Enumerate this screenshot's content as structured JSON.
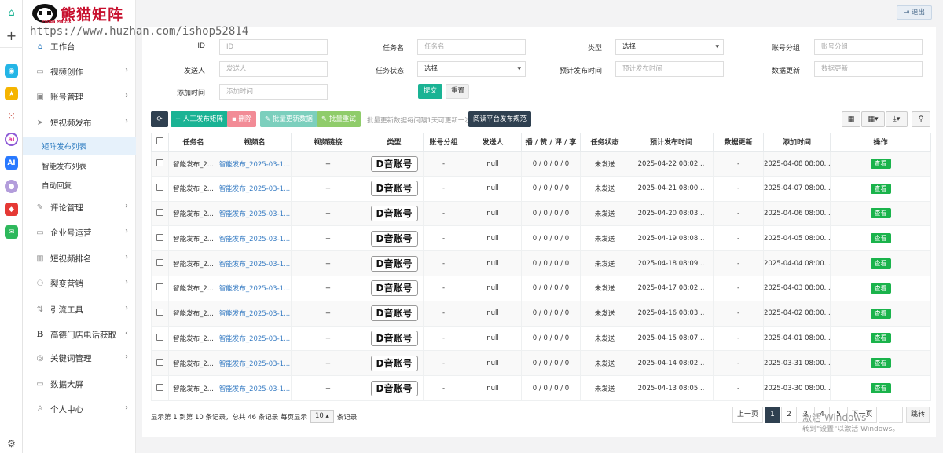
{
  "watermark": "https://www.huzhan.com/ishop52814",
  "logo": {
    "name": "熊猫矩阵",
    "sub": "Panda Matrix"
  },
  "topbar": {
    "logout_label": "退出"
  },
  "sidebar": {
    "items": [
      {
        "label": "工作台",
        "icon": "home-icon"
      },
      {
        "label": "视频创作",
        "icon": "video-icon"
      },
      {
        "label": "账号管理",
        "icon": "account-icon"
      },
      {
        "label": "短视频发布",
        "icon": "send-icon"
      },
      {
        "label": "评论管理",
        "icon": "comment-icon"
      },
      {
        "label": "企业号运营",
        "icon": "monitor-icon"
      },
      {
        "label": "短视频排名",
        "icon": "bar-chart-icon"
      },
      {
        "label": "裂变营销",
        "icon": "sitemap-icon"
      },
      {
        "label": "引流工具",
        "icon": "sort-icon"
      },
      {
        "label": "高德门店电话获取",
        "icon": "bold-b-icon"
      },
      {
        "label": "关键词管理",
        "icon": "target-icon"
      },
      {
        "label": "数据大屏",
        "icon": "screen-icon"
      },
      {
        "label": "个人中心",
        "icon": "user-icon"
      }
    ],
    "subitems": [
      {
        "label": "矩阵发布列表"
      },
      {
        "label": "智能发布列表"
      },
      {
        "label": "自动回复"
      }
    ]
  },
  "filters": {
    "id": {
      "label": "ID",
      "placeholder": "ID"
    },
    "task_name": {
      "label": "任务名",
      "placeholder": "任务名"
    },
    "type": {
      "label": "类型",
      "value": "选择"
    },
    "account_group": {
      "label": "账号分组",
      "placeholder": "账号分组"
    },
    "sender": {
      "label": "发送人",
      "placeholder": "发送人"
    },
    "task_status": {
      "label": "任务状态",
      "value": "选择"
    },
    "plan_time": {
      "label": "预计发布时间",
      "placeholder": "预计发布时间"
    },
    "data_update": {
      "label": "数据更新",
      "placeholder": "数据更新"
    },
    "add_time": {
      "label": "添加时间",
      "placeholder": "添加时间"
    },
    "submit_label": "提交",
    "reset_label": "重置"
  },
  "toolbar": {
    "manual_label": "人工发布矩阵",
    "delete_label": "删除",
    "batch_update_label": "批量更新数据",
    "batch_retry_label": "批量重试",
    "note": "批量更新数据每间隔1天可更新一次",
    "rules_label": "阅读平台发布规范"
  },
  "table": {
    "headers": [
      "任务名",
      "视频名",
      "视频链接",
      "类型",
      "账号分组",
      "发送人",
      "播 / 赞 / 评 / 享",
      "任务状态",
      "预计发布时间",
      "数据更新",
      "添加时间",
      "操作"
    ],
    "rows": [
      {
        "task": "智能发布_2...",
        "video": "智能发布_2025-03-1...",
        "link": "--",
        "type": "D音账号",
        "group": "-",
        "sender": "null",
        "stats": "0 / 0 / 0 / 0",
        "status": "未发送",
        "plan": "2025-04-22 08:02...",
        "update": "-",
        "added": "2025-04-08 08:00...",
        "action": "查看"
      },
      {
        "task": "智能发布_2...",
        "video": "智能发布_2025-03-1...",
        "link": "--",
        "type": "D音账号",
        "group": "-",
        "sender": "null",
        "stats": "0 / 0 / 0 / 0",
        "status": "未发送",
        "plan": "2025-04-21 08:00...",
        "update": "-",
        "added": "2025-04-07 08:00...",
        "action": "查看"
      },
      {
        "task": "智能发布_2...",
        "video": "智能发布_2025-03-1...",
        "link": "--",
        "type": "D音账号",
        "group": "-",
        "sender": "null",
        "stats": "0 / 0 / 0 / 0",
        "status": "未发送",
        "plan": "2025-04-20 08:03...",
        "update": "-",
        "added": "2025-04-06 08:00...",
        "action": "查看"
      },
      {
        "task": "智能发布_2...",
        "video": "智能发布_2025-03-1...",
        "link": "--",
        "type": "D音账号",
        "group": "-",
        "sender": "null",
        "stats": "0 / 0 / 0 / 0",
        "status": "未发送",
        "plan": "2025-04-19 08:08...",
        "update": "-",
        "added": "2025-04-05 08:00...",
        "action": "查看"
      },
      {
        "task": "智能发布_2...",
        "video": "智能发布_2025-03-1...",
        "link": "--",
        "type": "D音账号",
        "group": "-",
        "sender": "null",
        "stats": "0 / 0 / 0 / 0",
        "status": "未发送",
        "plan": "2025-04-18 08:09...",
        "update": "-",
        "added": "2025-04-04 08:00...",
        "action": "查看"
      },
      {
        "task": "智能发布_2...",
        "video": "智能发布_2025-03-1...",
        "link": "--",
        "type": "D音账号",
        "group": "-",
        "sender": "null",
        "stats": "0 / 0 / 0 / 0",
        "status": "未发送",
        "plan": "2025-04-17 08:02...",
        "update": "-",
        "added": "2025-04-03 08:00...",
        "action": "查看"
      },
      {
        "task": "智能发布_2...",
        "video": "智能发布_2025-03-1...",
        "link": "--",
        "type": "D音账号",
        "group": "-",
        "sender": "null",
        "stats": "0 / 0 / 0 / 0",
        "status": "未发送",
        "plan": "2025-04-16 08:03...",
        "update": "-",
        "added": "2025-04-02 08:00...",
        "action": "查看"
      },
      {
        "task": "智能发布_2...",
        "video": "智能发布_2025-03-1...",
        "link": "--",
        "type": "D音账号",
        "group": "-",
        "sender": "null",
        "stats": "0 / 0 / 0 / 0",
        "status": "未发送",
        "plan": "2025-04-15 08:07...",
        "update": "-",
        "added": "2025-04-01 08:00...",
        "action": "查看"
      },
      {
        "task": "智能发布_2...",
        "video": "智能发布_2025-03-1...",
        "link": "--",
        "type": "D音账号",
        "group": "-",
        "sender": "null",
        "stats": "0 / 0 / 0 / 0",
        "status": "未发送",
        "plan": "2025-04-14 08:02...",
        "update": "-",
        "added": "2025-03-31 08:00...",
        "action": "查看"
      },
      {
        "task": "智能发布_2...",
        "video": "智能发布_2025-03-1...",
        "link": "--",
        "type": "D音账号",
        "group": "-",
        "sender": "null",
        "stats": "0 / 0 / 0 / 0",
        "status": "未发送",
        "plan": "2025-04-13 08:05...",
        "update": "-",
        "added": "2025-03-30 08:00...",
        "action": "查看"
      }
    ]
  },
  "pagination": {
    "summary_prefix": "显示第 1 到第 10 条记录，总共 46 条记录 每页显示",
    "page_size": "10",
    "summary_suffix": "条记录",
    "prev": "上一页",
    "pages": [
      "1",
      "2",
      "3",
      "4",
      "5"
    ],
    "next": "下一页",
    "jump_label": "跳转"
  },
  "windows_notice": {
    "title": "激活 Windows",
    "body": "转到\"设置\"以激活 Windows。"
  },
  "colors": {
    "primary": "#2f4050",
    "teal": "#1ab394",
    "red": "#ed5565",
    "green": "#1ab34b",
    "lightgreen": "#8bc34a",
    "link": "#3a7ec4"
  }
}
